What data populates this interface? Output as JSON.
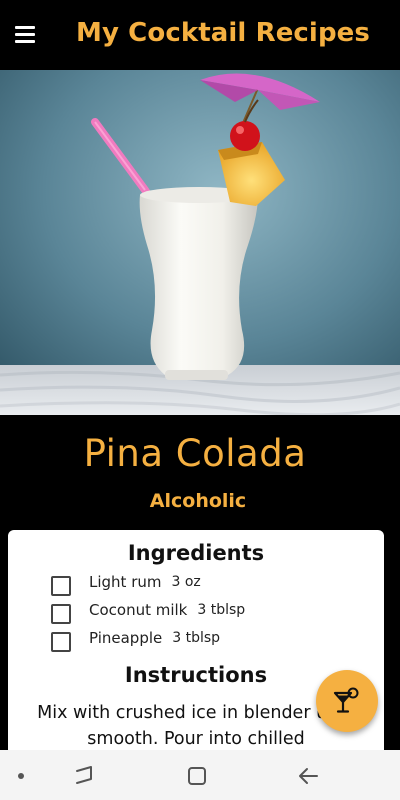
{
  "app_bar": {
    "title": "My Cocktail Recipes",
    "menu_icon": "hamburger-menu-icon"
  },
  "drink": {
    "name": "Pina Colada",
    "category": "Alcoholic",
    "image_alt": "Pina Colada in a hurricane glass with pineapple slice, cherry, pink straw and umbrella"
  },
  "ingredients": {
    "title": "Ingredients",
    "items": [
      {
        "name": "Light rum",
        "measure": "3 oz",
        "checked": false
      },
      {
        "name": "Coconut milk",
        "measure": "3 tblsp",
        "checked": false
      },
      {
        "name": "Pineapple",
        "measure": "3 tblsp",
        "checked": false
      }
    ]
  },
  "instructions": {
    "title": "Instructions",
    "text": "Mix with crushed ice in blender until smooth. Pour into chilled"
  },
  "fab": {
    "icon": "cocktail-glass-icon"
  },
  "colors": {
    "accent": "#f5b041",
    "background": "#000000",
    "card": "#ffffff"
  },
  "nav_bar": {
    "icons": [
      "dot-icon",
      "recent-apps-icon",
      "home-icon",
      "back-icon"
    ]
  }
}
